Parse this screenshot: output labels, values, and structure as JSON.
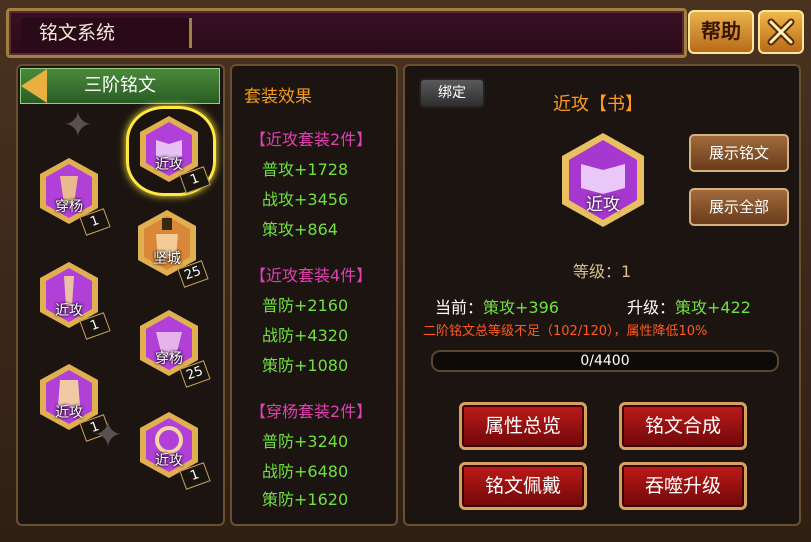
{
  "window": {
    "title": "铭文系统",
    "help_label": "帮助"
  },
  "left": {
    "tier_title": "三阶铭文",
    "runes": [
      {
        "label": "近攻",
        "count": "1",
        "selected": true
      },
      {
        "label": "穿杨",
        "count": "1"
      },
      {
        "label": "坚城",
        "count": "25"
      },
      {
        "label": "近攻",
        "count": "1"
      },
      {
        "label": "穿杨",
        "count": "25"
      },
      {
        "label": "近攻",
        "count": "1"
      },
      {
        "label": "近攻",
        "count": "1"
      }
    ]
  },
  "sets": {
    "title": "套装效果",
    "groups": [
      {
        "head": "【近攻套装2件】",
        "lines": [
          "普攻+1728",
          "战攻+3456",
          "策攻+864"
        ]
      },
      {
        "head": "【近攻套装4件】",
        "lines": [
          "普防+2160",
          "战防+4320",
          "策防+1080"
        ]
      },
      {
        "head": "【穿杨套装2件】",
        "lines": [
          "普防+3240",
          "战防+6480",
          "策防+1620"
        ]
      }
    ]
  },
  "detail": {
    "bind_label": "绑定",
    "item_name": "近攻【书】",
    "icon_label": "近攻",
    "show_rune_label": "展示铭文",
    "show_all_label": "展示全部",
    "level_text": "等级：1",
    "current_label": "当前：",
    "current_value": "策攻+396",
    "upgrade_label": "升级：",
    "upgrade_value": "策攻+422",
    "warning": "二阶铭文总等级不足（102/120），属性降低10%",
    "progress_text": "0/4400",
    "progress_fraction": 0,
    "buttons": {
      "overview": "属性总览",
      "compose": "铭文合成",
      "wear": "铭文佩戴",
      "devour": "吞噬升级"
    }
  },
  "colors": {
    "rune_purple": "#b040d8",
    "rune_gold": "#e0b050",
    "rune_orange": "#d88838"
  }
}
